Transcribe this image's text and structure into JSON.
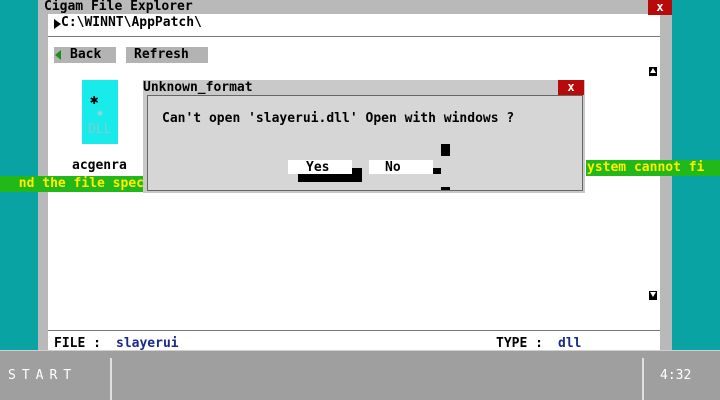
{
  "window": {
    "title": "Cigam File Explorer",
    "close_label": "x",
    "path": "C:\\WINNT\\AppPatch\\",
    "back_label": "Back",
    "refresh_label": "Refresh"
  },
  "files": [
    {
      "name": "acgenra",
      "icon_ext": "DLL",
      "icon": "dll-file-icon"
    }
  ],
  "status": {
    "file_label": "FILE :",
    "file_value": "slayerui",
    "type_label": "TYPE :",
    "type_value": "dll"
  },
  "error_marquee": {
    "left_text": "nd the file spec",
    "right_text": "ystem cannot fi"
  },
  "dialog": {
    "title": "Unknown_format",
    "close_label": "x",
    "message": "Can't open 'slayerui.dll' Open with windows ?",
    "yes_label": "Yes",
    "no_label": "No"
  },
  "taskbar": {
    "start_label": "START",
    "clock": "4:32"
  },
  "colors": {
    "desktop": "#0aa3a3",
    "close_button": "#b80a0a",
    "marquee_bg": "#22b81a",
    "marquee_text": "#ffee00",
    "status_value": "#1a2a8c",
    "file_icon": "#19ebeb"
  }
}
